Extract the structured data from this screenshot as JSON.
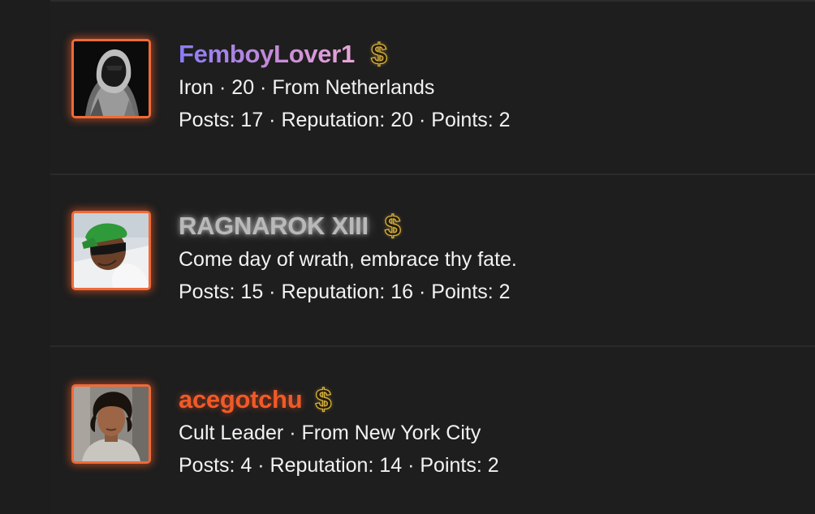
{
  "members": [
    {
      "username": "FemboyLover1",
      "badge_icon": "dollar-sign-icon",
      "subtitle": "Iron · 20 · From Netherlands",
      "stats": "Posts: 17 · Reputation: 20 · Points: 2",
      "name_style": "purple-gradient"
    },
    {
      "username": "RAGNAROK XIII",
      "badge_icon": "dollar-sign-icon",
      "subtitle": "Come day of wrath, embrace thy fate.",
      "stats": "Posts: 15 · Reputation: 16 · Points: 2",
      "name_style": "silver-glow"
    },
    {
      "username": "acegotchu",
      "badge_icon": "dollar-sign-icon",
      "subtitle": "Cult Leader · From New York City",
      "stats": "Posts: 4 · Reputation: 14 · Points: 2",
      "name_style": "orange-glow"
    }
  ],
  "badge_glyph": "$",
  "colors": {
    "background": "#1e1e1e",
    "divider": "#2b2b2b",
    "avatar_border": "#f06a38",
    "badge_gold": "#d9b13e",
    "text": "#f2f2f2",
    "name_orange": "#f05a28",
    "name_silver": "#b9b9b9",
    "name_gradient_start": "#8a7cf6",
    "name_gradient_end": "#e8a7d8"
  }
}
